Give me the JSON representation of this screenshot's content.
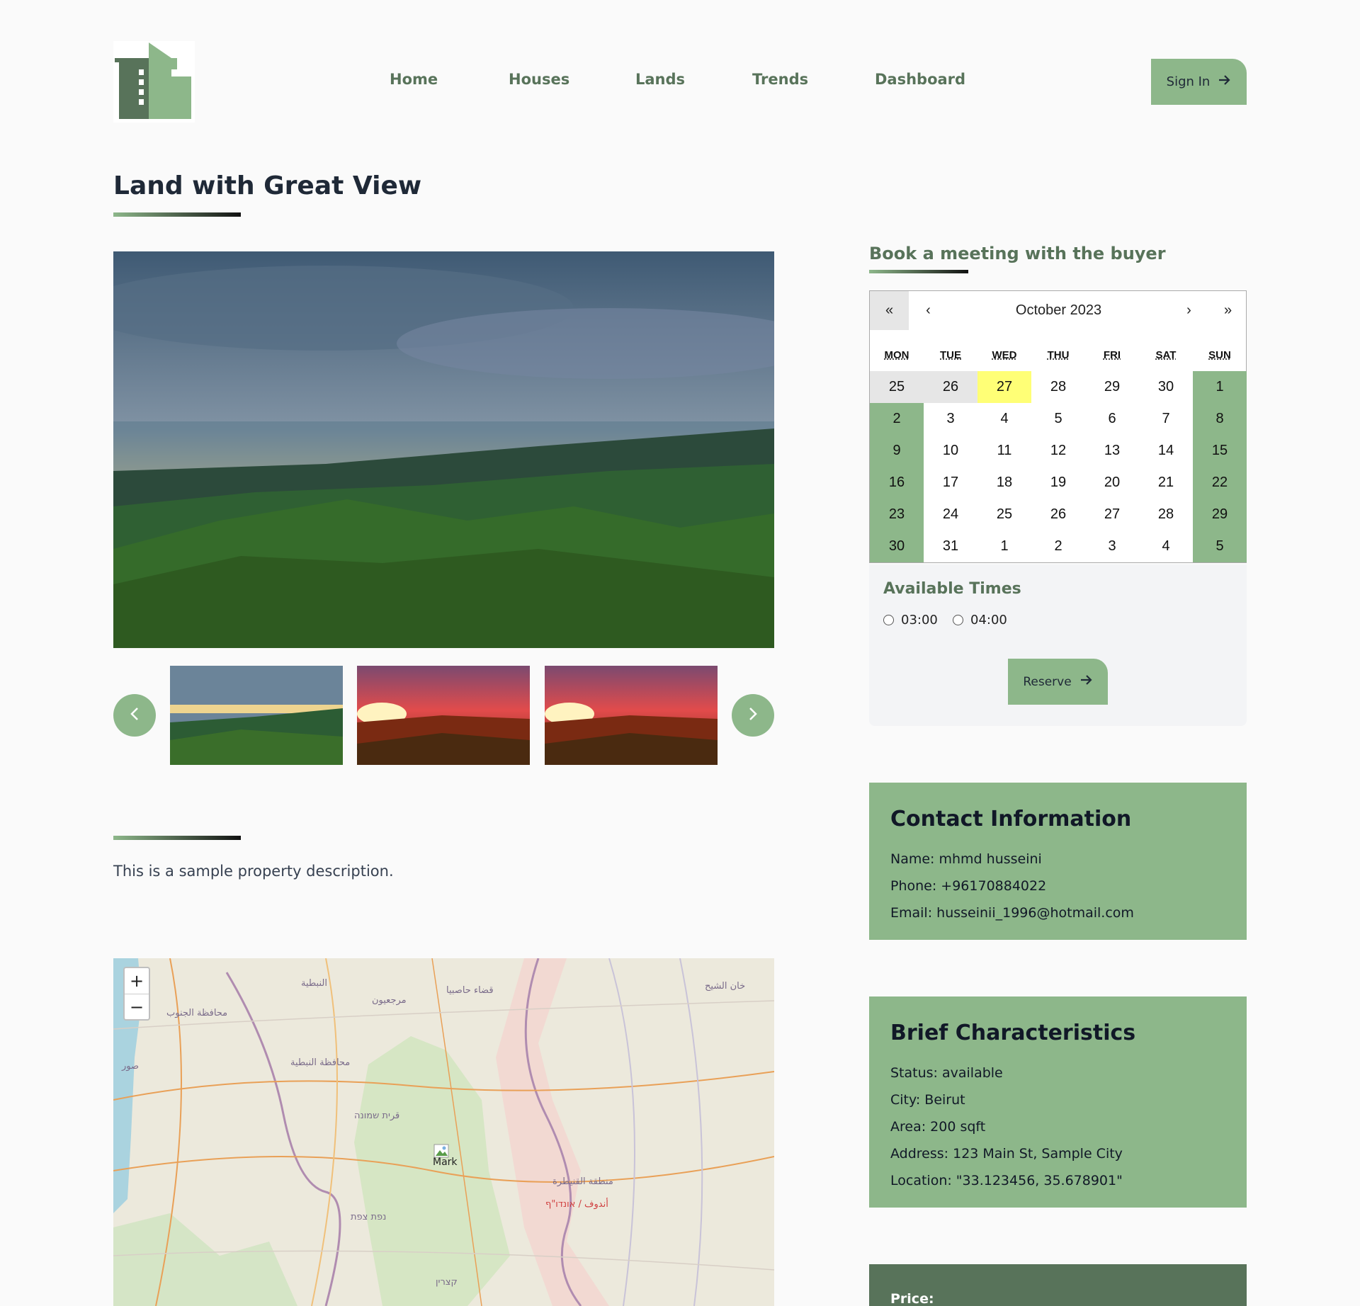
{
  "header": {
    "nav": [
      "Home",
      "Houses",
      "Lands",
      "Trends",
      "Dashboard"
    ],
    "signin_label": "Sign In"
  },
  "page": {
    "title": "Land with Great View",
    "description": "This is a sample property description."
  },
  "gallery": {
    "prev_icon": "chevron-left-icon",
    "next_icon": "chevron-right-icon",
    "thumbnails": [
      "landscape-daylight",
      "landscape-sunset",
      "landscape-sunset"
    ]
  },
  "booking": {
    "title": "Book a meeting with the buyer",
    "month_label": "October 2023",
    "nav": {
      "prev_year": "«",
      "prev_month": "‹",
      "next_month": "›",
      "next_year": "»"
    },
    "weekdays": [
      "MON",
      "TUE",
      "WED",
      "THU",
      "FRI",
      "SAT",
      "SUN"
    ],
    "weeks": [
      [
        "25",
        "26",
        "27",
        "28",
        "29",
        "30",
        "1"
      ],
      [
        "2",
        "3",
        "4",
        "5",
        "6",
        "7",
        "8"
      ],
      [
        "9",
        "10",
        "11",
        "12",
        "13",
        "14",
        "15"
      ],
      [
        "16",
        "17",
        "18",
        "19",
        "20",
        "21",
        "22"
      ],
      [
        "23",
        "24",
        "25",
        "26",
        "27",
        "28",
        "29"
      ],
      [
        "30",
        "31",
        "1",
        "2",
        "3",
        "4",
        "5"
      ]
    ],
    "available_times_title": "Available Times",
    "times": [
      "03:00",
      "04:00"
    ],
    "reserve_label": "Reserve"
  },
  "contact": {
    "title": "Contact Information",
    "name": "Name: mhmd husseini",
    "phone": "Phone: +96170884022",
    "email": "Email: husseinii_1996@hotmail.com"
  },
  "characteristics": {
    "title": "Brief Characteristics",
    "status": "Status: available",
    "city": "City: Beirut",
    "area": "Area: 200 sqft",
    "address": "Address: 123 Main St, Sample City",
    "location": "Location: \"33.123456, 35.678901\""
  },
  "price": {
    "label": "Price:"
  },
  "map": {
    "zoom_in": "+",
    "zoom_out": "−",
    "marker_label": "Mark",
    "place_labels": [
      "النبطية",
      "محافظة الجنوب",
      "محافظة النبطية",
      "صور",
      "قرית שמונה",
      "منطقة القنيطرة",
      "خان الشيح",
      "أندوف / אונדו\"ף",
      "קצרין",
      "נפת צפת",
      "مرجعيون",
      "قضاء حاصبيا"
    ]
  },
  "colors": {
    "accent": "#8db78a",
    "dark_accent": "#58735a",
    "today": "#ffff76"
  }
}
